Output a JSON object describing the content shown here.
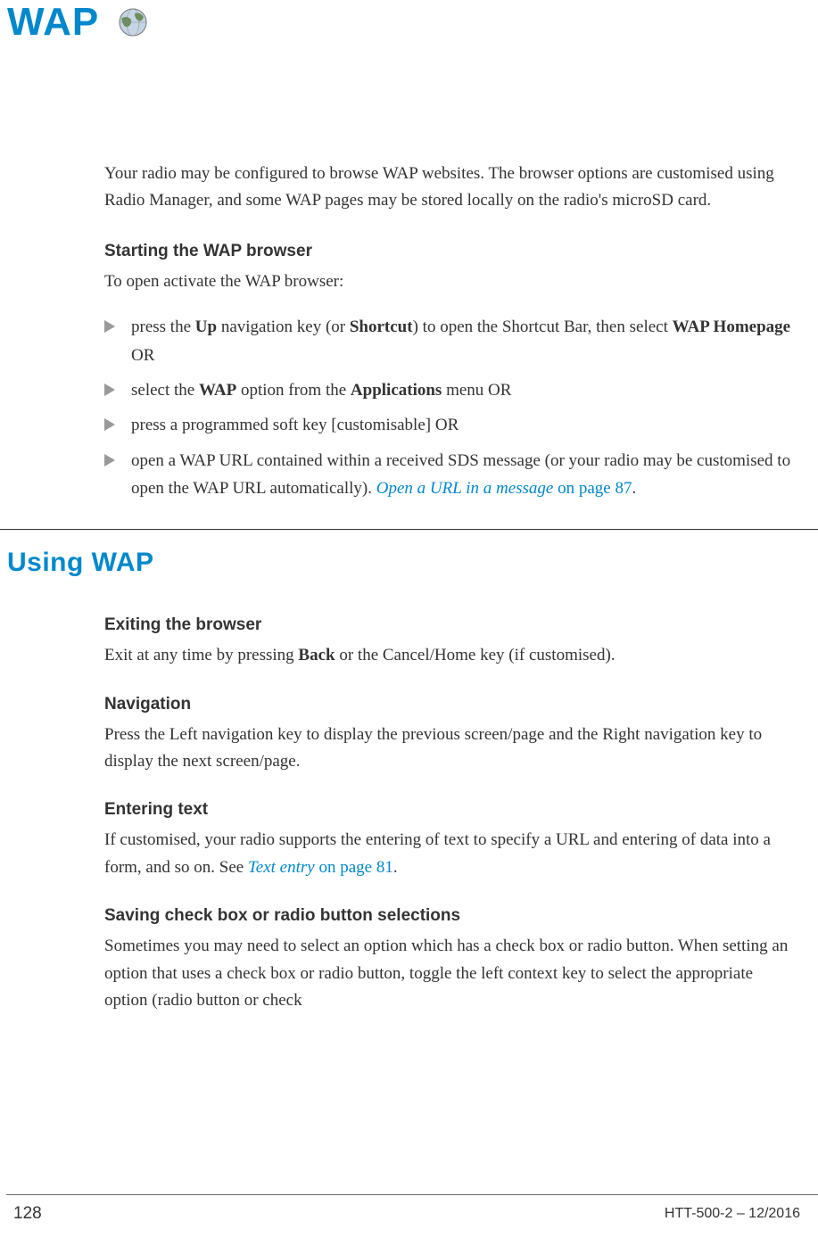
{
  "pageTitle": "WAP",
  "intro": "Your radio may be configured to browse WAP websites. The browser options are customised using Radio Manager, and some WAP pages may be stored locally on the radio's microSD card.",
  "starting": {
    "heading": "Starting the WAP browser",
    "intro": "To open activate the WAP browser:",
    "bullets": {
      "b1_pre": "press the ",
      "b1_bold1": "Up",
      "b1_mid1": " navigation key (or ",
      "b1_bold2": "Shortcut",
      "b1_mid2": ") to open the Shortcut Bar, then select ",
      "b1_bold3": "WAP Homepage",
      "b1_suffix": " OR",
      "b2_pre": "select the ",
      "b2_bold1": "WAP",
      "b2_mid1": " option from the ",
      "b2_bold2": "Applications",
      "b2_suffix": " menu OR",
      "b3": "press a programmed soft key [customisable] OR",
      "b4_pre": "open a WAP URL contained within a received SDS message (or your radio may be customised to open the WAP URL automatically). ",
      "b4_link": "Open a URL in a message",
      "b4_linksuffix": " on page 87",
      "b4_period": "."
    }
  },
  "sectionHeading": "Using WAP",
  "exiting": {
    "heading": "Exiting the browser",
    "text_pre": "Exit at any time by pressing ",
    "text_bold": "Back",
    "text_suffix": " or the Cancel/Home key (if customised)."
  },
  "navigation": {
    "heading": "Navigation",
    "text": "Press the Left navigation key to display the previous screen/page and the Right navigation key to display the next screen/page."
  },
  "entering": {
    "heading": "Entering text",
    "text_pre": "If customised, your radio supports the entering of text to specify a URL and entering of data into a form, and so on. See ",
    "text_link": "Text entry",
    "text_linksuffix": " on page 81",
    "text_period": "."
  },
  "saving": {
    "heading": "Saving check box or radio button selections",
    "text": "Sometimes you may need to select an option which has a check box or radio button. When setting an option that uses a check box or radio button, toggle the left context key to select the appropriate option (radio button or check"
  },
  "footer": {
    "pageNumber": "128",
    "docId": "HTT-500-2 – 12/2016"
  }
}
